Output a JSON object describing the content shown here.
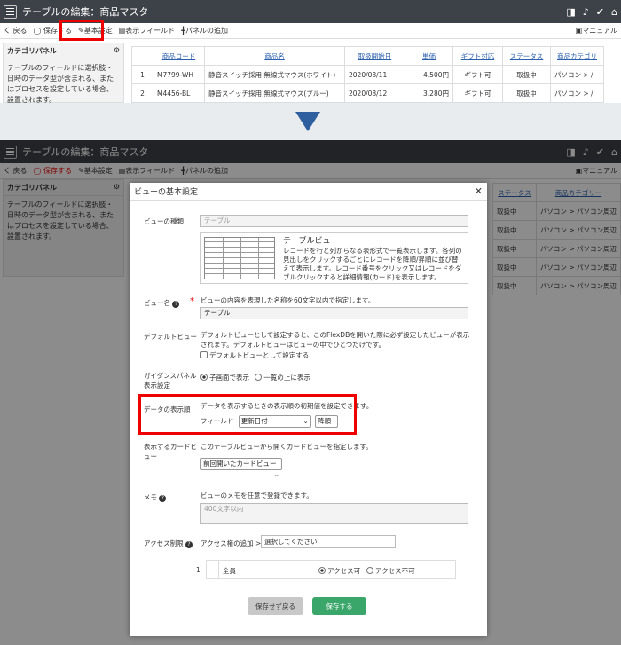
{
  "header": {
    "title": "テーブルの編集：商品マスタ"
  },
  "toolbar": {
    "back": "く 戻る",
    "save": "◯ 保存する",
    "basic": "✎基本設定",
    "fields": "▤表示フィールド",
    "panel": "╋パネルの追加",
    "manual": "▣マニュアル"
  },
  "side": {
    "title": "カテゴリパネル",
    "body": "テーブルのフィールドに選択肢・日時のデータ型が含まれる、またはプロセスを設定している場合、設置されます。"
  },
  "grid": {
    "headers": [
      "商品コード",
      "商品名",
      "取扱開始日",
      "単価",
      "ギフト対応",
      "ステータス",
      "商品カテゴリ"
    ],
    "rows": [
      [
        "1",
        "M7799-WH",
        "静音スイッチ採用 無線式マウス(ホワイト)",
        "2020/08/11",
        "4,500円",
        "ギフト可",
        "取扱中",
        "パソコン > /"
      ],
      [
        "2",
        "M4456-BL",
        "静音スイッチ採用 無線式マウス(ブルー)",
        "2020/08/12",
        "3,280円",
        "ギフト可",
        "取扱中",
        "パソコン > /"
      ]
    ]
  },
  "bg2": {
    "headers": [
      "ステータス",
      "商品カテゴリー"
    ],
    "rows": [
      [
        "取扱中",
        "パソコン > パソコン周辺"
      ],
      [
        "取扱中",
        "パソコン > パソコン周辺"
      ],
      [
        "取扱中",
        "パソコン > パソコン周辺"
      ],
      [
        "取扱中",
        "パソコン > パソコン周辺"
      ],
      [
        "取扱中",
        "パソコン > パソコン周辺"
      ]
    ]
  },
  "dialog": {
    "title": "ビューの基本設定",
    "viewtype_label": "ビューの種類",
    "viewtype_value": "テーブル",
    "tableview_title": "テーブルビュー",
    "tableview_desc": "レコードを行と列からなる表形式で一覧表示します。各列の見出しをクリックするごとにレコードを降順/昇順に並び替えて表示します。レコード番号をクリック又はレコードをダブルクリックすると詳細情報(カード)を表示します。",
    "viewname_label": "ビュー名",
    "viewname_help": "ビューの内容を表現した名称を60文字以内で指定します。",
    "viewname_value": "テーブル",
    "default_label": "デフォルトビュー",
    "default_help": "デフォルトビューとして設定すると、このFlexDBを開いた際に必ず設定したビューが表示されます。デフォルトビューはビューの中でひとつだけです。",
    "default_check": "デフォルトビューとして設定する",
    "guidance_label": "ガイダンスパネル表示設定",
    "guidance_opt1": "子画面で表示",
    "guidance_opt2": "一覧の上に表示",
    "order_label": "データの表示順",
    "order_help": "データを表示するときの表示順の初期値を設定できます。",
    "order_field_label": "フィールド",
    "order_field_value": "更新日付",
    "order_dir_value": "降順",
    "card_label": "表示するカードビュー",
    "card_help": "このテーブルビューから開くカードビューを指定します。",
    "card_value": "前回開いたカードビュー",
    "memo_label": "メモ",
    "memo_help": "ビューのメモを任意で登録できます。",
    "memo_placeholder": "400文字以内",
    "access_label": "アクセス制限",
    "access_add": "アクセス権の追加 >",
    "access_select": "選択してください",
    "access_row_no": "1",
    "access_row_name": "全員",
    "access_ok": "アクセス可",
    "access_ng": "アクセス不可",
    "btn_nosave": "保存せず戻る",
    "btn_save": "保存する"
  },
  "colors": {
    "accent": "#3aa66a",
    "red": "#e00000",
    "header": "#3d4148"
  }
}
